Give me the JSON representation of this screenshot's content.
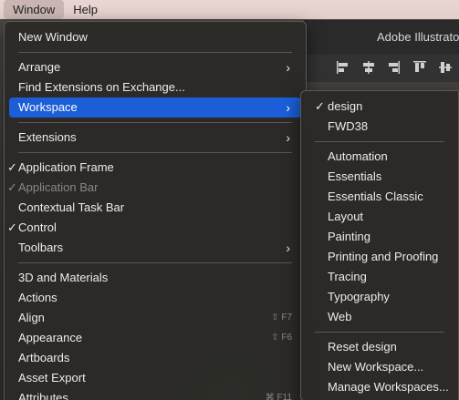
{
  "menubar": {
    "items": [
      {
        "label": "Window",
        "active": true
      },
      {
        "label": "Help",
        "active": false
      }
    ]
  },
  "app": {
    "title": "Adobe Illustrato"
  },
  "window_menu": {
    "items": [
      {
        "label": "New Window"
      },
      {
        "label": "Arrange",
        "submenu": true
      },
      {
        "label": "Find Extensions on Exchange..."
      },
      {
        "label": "Workspace",
        "submenu": true,
        "highlighted": true
      },
      {
        "label": "Extensions",
        "submenu": true
      },
      {
        "label": "Application Frame",
        "checked": true
      },
      {
        "label": "Application Bar",
        "checked": true,
        "disabled": true
      },
      {
        "label": "Contextual Task Bar"
      },
      {
        "label": "Control",
        "checked": true
      },
      {
        "label": "Toolbars",
        "submenu": true
      },
      {
        "label": "3D and Materials"
      },
      {
        "label": "Actions"
      },
      {
        "label": "Align",
        "shortcut": "⇧ F7"
      },
      {
        "label": "Appearance",
        "shortcut": "⇧ F6"
      },
      {
        "label": "Artboards"
      },
      {
        "label": "Asset Export"
      },
      {
        "label": "Attributes",
        "shortcut": "⌘ F11"
      }
    ],
    "check_glyph": "✓",
    "arrow_glyph": "›"
  },
  "workspace_menu": {
    "items": [
      {
        "label": "design",
        "checked": true
      },
      {
        "label": "FWD38"
      },
      {
        "label": "Automation"
      },
      {
        "label": "Essentials"
      },
      {
        "label": "Essentials Classic"
      },
      {
        "label": "Layout"
      },
      {
        "label": "Painting"
      },
      {
        "label": "Printing and Proofing"
      },
      {
        "label": "Tracing"
      },
      {
        "label": "Typography"
      },
      {
        "label": "Web"
      },
      {
        "label": "Reset design"
      },
      {
        "label": "New Workspace..."
      },
      {
        "label": "Manage Workspaces..."
      }
    ]
  },
  "colors": {
    "menu_bg": "#2c2a28",
    "highlight": "#1b5ed8",
    "menubar_bg": "#e9d6d2"
  },
  "icons": [
    "checkmark-icon",
    "chevron-right-icon",
    "align-left-icon",
    "align-center-icon",
    "align-right-icon",
    "align-top-icon",
    "align-middle-icon"
  ]
}
